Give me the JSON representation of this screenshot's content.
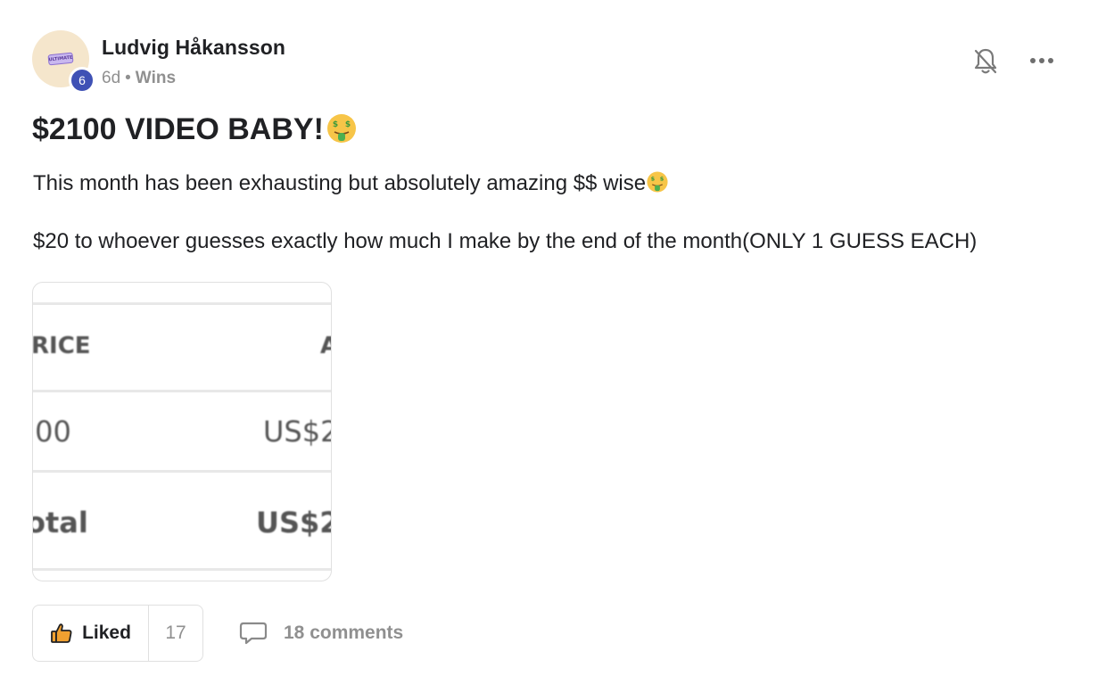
{
  "post": {
    "author": {
      "name": "Ludvig Håkansson",
      "level": "6",
      "avatar_text": "ULTIMATE"
    },
    "meta": {
      "time": "6d",
      "separator": "•",
      "category": "Wins"
    },
    "title": "$2100 VIDEO BABY!",
    "title_emoji": "money-mouth-face-icon",
    "body": {
      "line1": "This month has been exhausting but absolutely amazing $$ wise",
      "line2": "$20 to whoever guesses exactly how much I make by the end of the month(ONLY 1 GUESS EACH)"
    },
    "attachment": {
      "header_left": "RICE",
      "header_right": "A",
      "row_left": ".00",
      "row_right": "US$2",
      "total_left": "otal",
      "total_right": "US$2"
    }
  },
  "actions": {
    "like_label": "Liked",
    "like_count": "17",
    "comments_label": "18 comments"
  },
  "icons": {
    "bell": "bell-off-icon",
    "more": "more-horizontal-icon",
    "like": "thumbs-up-icon",
    "comment": "comment-bubble-icon"
  },
  "colors": {
    "level_badge": "#3f51b5",
    "avatar_bg": "#f5e6cc",
    "meta_text": "#909090",
    "like_icon": "#f0a030"
  }
}
